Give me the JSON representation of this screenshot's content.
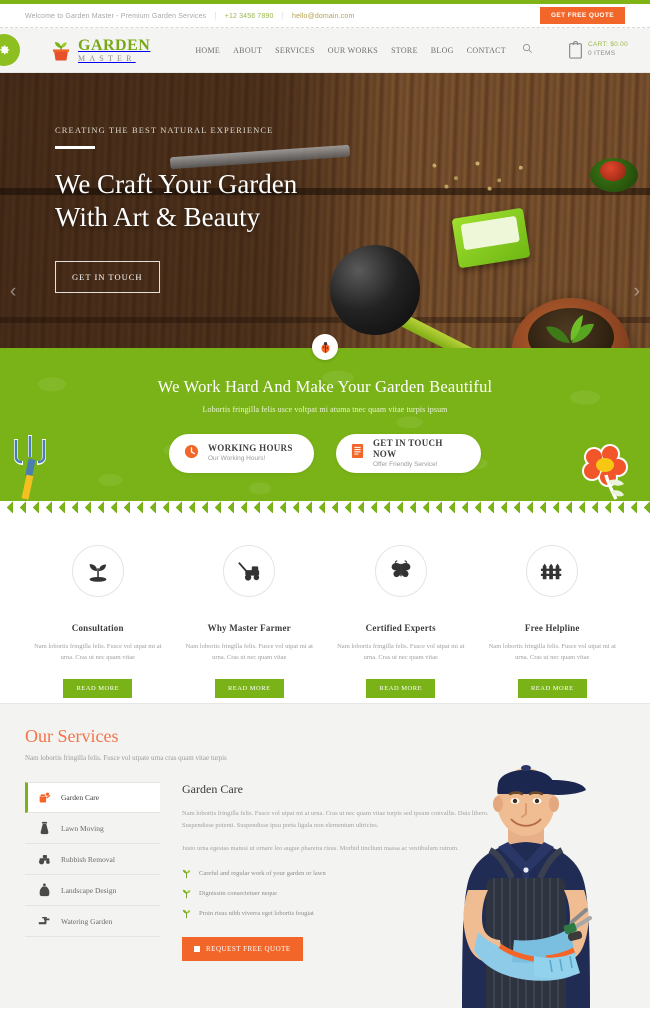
{
  "topbar": {
    "welcome": "Welcome to Garden Master - Premium Garden Services",
    "phone": "+12 3456 7890",
    "email": "hello@domain.com",
    "quote_button": "GET FREE QUOTE",
    "sep": "|"
  },
  "header": {
    "logo_primary": "GARDEN",
    "logo_secondary": "MASTER",
    "nav": [
      {
        "label": "HOME"
      },
      {
        "label": "ABOUT"
      },
      {
        "label": "SERVICES"
      },
      {
        "label": "OUR WORKS"
      },
      {
        "label": "STORE"
      },
      {
        "label": "BLOG"
      },
      {
        "label": "CONTACT"
      }
    ],
    "search_icon": "search-icon",
    "gear_icon": "gear-icon",
    "cart": {
      "line1": "CART:  $0.00",
      "line2": "0 ITEMS",
      "icon": "cart-icon"
    }
  },
  "hero": {
    "kicker": "CREATING THE BEST NATURAL EXPERIENCE",
    "title_line1": "We Craft Your Garden",
    "title_line2": "With Art & Beauty",
    "button": "GET IN TOUCH",
    "prev_arrow": "‹",
    "next_arrow": "›",
    "scroll_badge_icon": "ladybug-icon"
  },
  "green_band": {
    "title": "We Work Hard And Make Your Garden Beautiful",
    "subtitle": "Lobortis fringilla felis usce voltpat mi atuma tnec quam vitae turpis ipsum",
    "pills": [
      {
        "icon": "clock-icon",
        "title": "WORKING HOURS",
        "subtitle": "Our Working Hours!"
      },
      {
        "icon": "document-icon",
        "title": "GET IN TOUCH NOW",
        "subtitle": "Offer Friendly Service!"
      }
    ],
    "decor_left": "pitchfork-icon",
    "decor_right": "flower-icon",
    "accent_color": "#7ab317"
  },
  "features": [
    {
      "icon": "seedling-icon",
      "title": "Consultation",
      "desc": "Nam lobortis fringilla felis. Fusce vol utpat mi at urna. Cras ut nec quam vitae",
      "button": "READ MORE"
    },
    {
      "icon": "lawnmower-icon",
      "title": "Why Master Farmer",
      "desc": "Nam lobortis fringilla felis. Fusce vol utpat mi at urna. Cras ut nec quam vitae",
      "button": "READ MORE"
    },
    {
      "icon": "butterfly-icon",
      "title": "Certified Experts",
      "desc": "Nam lobortis fringilla felis. Fusce vol utpat mi at urna. Cras ut nec quam vitae",
      "button": "READ MORE"
    },
    {
      "icon": "fence-icon",
      "title": "Free Helpline",
      "desc": "Nam lobortis fringilla felis. Fusce vol utpat mi at urna. Cras ut nec quam vitae",
      "button": "READ MORE"
    }
  ],
  "services": {
    "title": "Our Services",
    "subtitle": "Nam lobortis fringilla felis. Fusce vol utpate urna cras quam vitae turpis",
    "tabs": [
      {
        "label": "Garden Care",
        "icon": "watering-can-icon",
        "active": true
      },
      {
        "label": "Lawn Moving",
        "icon": "sprayer-icon",
        "active": false
      },
      {
        "label": "Rubbish Removal",
        "icon": "tractor-icon",
        "active": false
      },
      {
        "label": "Landscape Design",
        "icon": "sack-icon",
        "active": false
      },
      {
        "label": "Watering Garden",
        "icon": "faucet-icon",
        "active": false
      }
    ],
    "detail": {
      "title": "Garden Care",
      "paragraph1": "Nam lobortis fringilla felis. Fusce vol utpat mi at urna. Cras ut nec quam vitae turpis sed ipsum convallis. Duis libero. Suspendisse potenti. Suspendisse ipsu porta ligula non elementum ultricies.",
      "paragraph2": "Justo urna egestas matusi ut ornare leo augue pharetra risus. Morbid tincliunt massa ac vestibulum rutrum.",
      "bullets": [
        "Careful and regular work of your garden or lawn",
        "Dignissim consectetuer neque",
        "Proin risus nibh viverra eget lobortis feugiat"
      ],
      "button": "REQUEST FREE QUOTE"
    },
    "photo_alt": "gardener-photo",
    "accent_color": "#f2662a"
  }
}
